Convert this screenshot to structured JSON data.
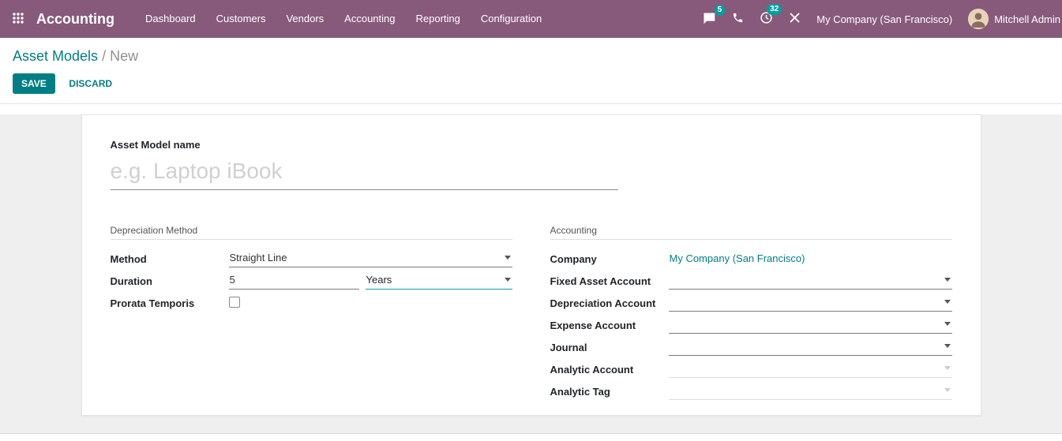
{
  "topbar": {
    "app_name": "Accounting",
    "menu": [
      "Dashboard",
      "Customers",
      "Vendors",
      "Accounting",
      "Reporting",
      "Configuration"
    ],
    "messages_badge": "5",
    "activities_badge": "32",
    "company": "My Company (San Francisco)",
    "user": "Mitchell Admin"
  },
  "breadcrumb": {
    "parent": "Asset Models",
    "separator": "/",
    "current": "New"
  },
  "actions": {
    "save": "SAVE",
    "discard": "DISCARD"
  },
  "form": {
    "name_label": "Asset Model name",
    "name_placeholder": "e.g. Laptop iBook",
    "sections": {
      "left": "Depreciation Method",
      "right": "Accounting"
    },
    "method": {
      "label": "Method",
      "value": "Straight Line"
    },
    "duration": {
      "label": "Duration",
      "value": "5",
      "unit": "Years"
    },
    "prorata": {
      "label": "Prorata Temporis",
      "checked": false
    },
    "company": {
      "label": "Company",
      "value": "My Company (San Francisco)"
    },
    "right_fields": [
      {
        "label": "Fixed Asset Account",
        "readonly": false
      },
      {
        "label": "Depreciation Account",
        "readonly": false
      },
      {
        "label": "Expense Account",
        "readonly": false
      },
      {
        "label": "Journal",
        "readonly": false
      },
      {
        "label": "Analytic Account",
        "readonly": true
      },
      {
        "label": "Analytic Tag",
        "readonly": true
      }
    ]
  },
  "colors": {
    "topbar": "#875A7B",
    "primary": "#017E84",
    "badge": "#00A09D"
  }
}
